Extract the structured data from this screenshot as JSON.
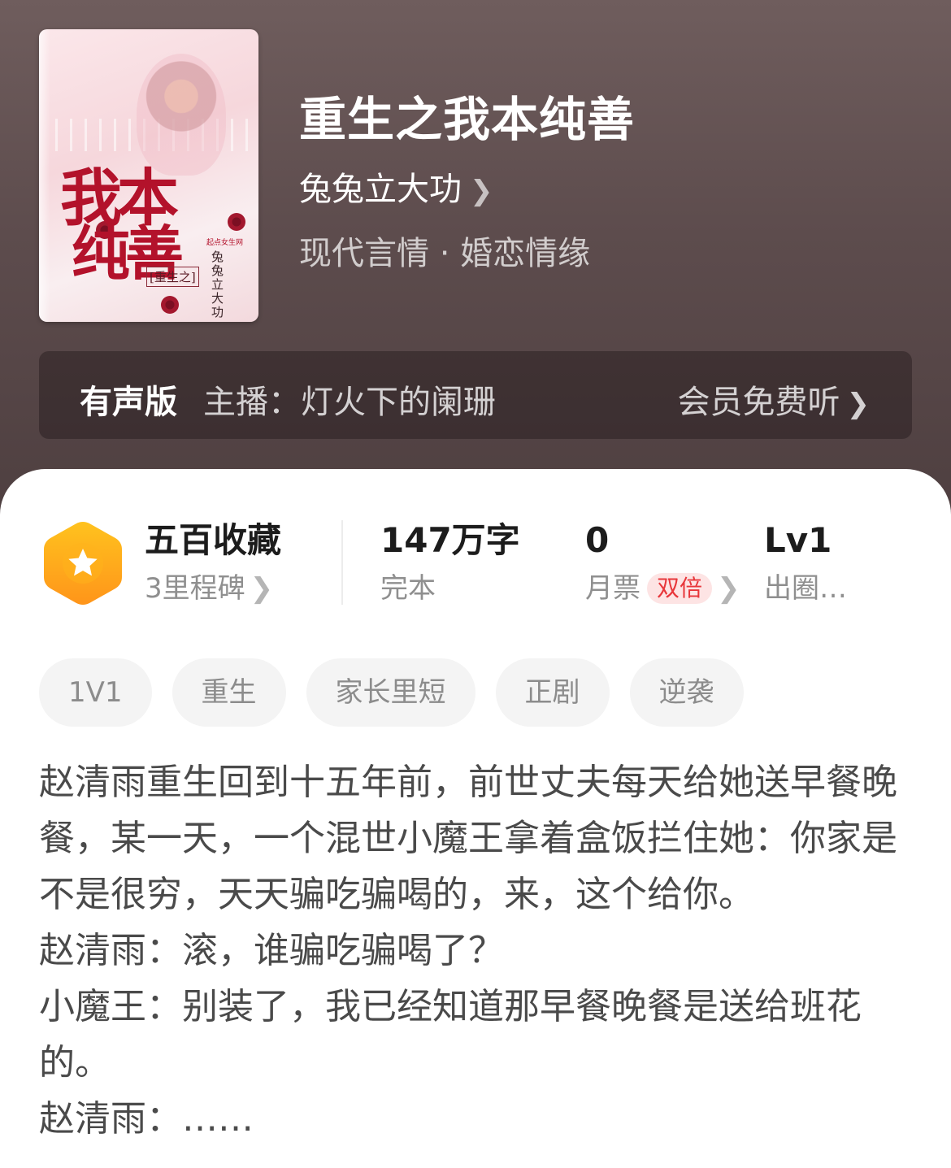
{
  "book": {
    "title": "重生之我本纯善",
    "author": "兔兔立大功",
    "genre": "现代言情 · 婚恋情缘",
    "cover": {
      "title_line1": "我本",
      "title_line2": "纯善",
      "subtitle": "[重生之]",
      "author": "兔兔立大功",
      "publisher": "起点女生网"
    }
  },
  "audio": {
    "label": "有声版",
    "host": "主播：灯火下的阑珊",
    "free_label": "会员免费听"
  },
  "stats": {
    "collection_title": "五百收藏",
    "collection_sub": "3里程碑",
    "words_title": "147万字",
    "words_sub": "完本",
    "tickets_value": "0",
    "tickets_label": "月票",
    "tickets_badge": "双倍",
    "level_value": "Lv1",
    "level_sub": "出圈…"
  },
  "tags": [
    "1V1",
    "重生",
    "家长里短",
    "正剧",
    "逆袭"
  ],
  "description": [
    "赵清雨重生回到十五年前，前世丈夫每天给她送早餐晚餐，某一天，一个混世小魔王拿着盒饭拦住她：你家是不是很穷，天天骗吃骗喝的，来，这个给你。",
    "赵清雨：滚，谁骗吃骗喝了？",
    "小魔王：别装了，我已经知道那早餐晚餐是送给班花的。",
    "赵清雨：……"
  ],
  "colors": {
    "hero_bg": "#5d4c4d",
    "badge_orange": "#ffa21c",
    "double_badge_text": "#e8373b",
    "cover_title_red": "#b3122b"
  },
  "icons": {
    "chevron": "chevron-right-icon",
    "milestone": "star-hexagon-icon"
  }
}
